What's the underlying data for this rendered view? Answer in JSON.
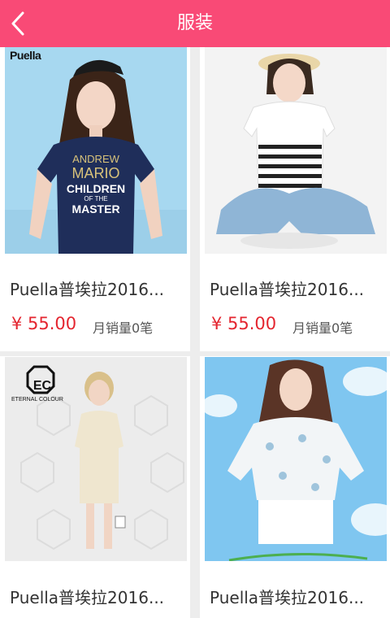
{
  "header": {
    "title": "服装",
    "background_color": "#f94a76",
    "back_icon": "chevron-left-icon"
  },
  "products": [
    {
      "brand_logo": "Puella",
      "shirt_text": [
        "ANDREW",
        "MARIO",
        "CHILDREN",
        "OF THE",
        "MASTER"
      ],
      "name": "Puella普埃拉2016...",
      "price": "¥ 55.00",
      "sales": "月销量0笔"
    },
    {
      "name": "Puella普埃拉2016...",
      "price": "¥ 55.00",
      "sales": "月销量0笔"
    },
    {
      "logo_text": "EC",
      "logo_subtext": "ETERNAL COLOUR",
      "name": "Puella普埃拉2016..."
    },
    {
      "name": "Puella普埃拉2016..."
    }
  ],
  "colors": {
    "accent": "#f94a76",
    "price": "#e4252f",
    "background": "#ededed"
  }
}
